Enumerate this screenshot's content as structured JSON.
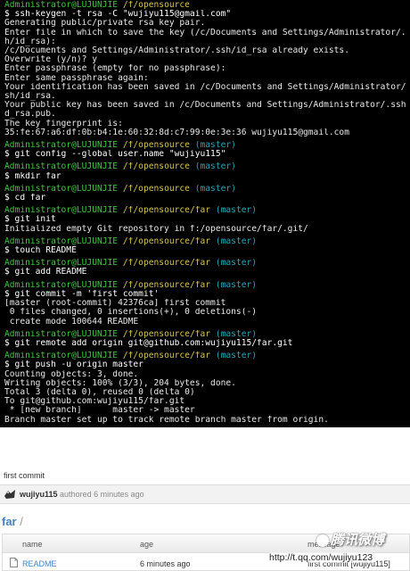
{
  "terminal": {
    "panels": [
      {
        "prompt": {
          "user": "Administrator@LUJUNJIE",
          "path": "/f/opensource",
          "branch": ""
        },
        "lines": [
          {
            "t": "cmd",
            "s": "$ ssh-keygen -t rsa -C \"wujiyu115@gmail.com\""
          },
          {
            "t": "out",
            "s": "Generating public/private rsa key pair."
          },
          {
            "t": "out",
            "s": "Enter file in which to save the key (/c/Documents and Settings/Administrator/.ss"
          },
          {
            "t": "out",
            "s": "h/id_rsa):"
          },
          {
            "t": "out",
            "s": "/c/Documents and Settings/Administrator/.ssh/id_rsa already exists."
          },
          {
            "t": "out",
            "s": "Overwrite (y/n)? y"
          },
          {
            "t": "out",
            "s": "Enter passphrase (empty for no passphrase):"
          },
          {
            "t": "out",
            "s": "Enter same passphrase again:"
          },
          {
            "t": "out",
            "s": "Your identification has been saved in /c/Documents and Settings/Administrator/.s"
          },
          {
            "t": "out",
            "s": "sh/id_rsa."
          },
          {
            "t": "out",
            "s": "Your public key has been saved in /c/Documents and Settings/Administrator/.ssh/i"
          },
          {
            "t": "out",
            "s": "d_rsa.pub."
          },
          {
            "t": "out",
            "s": "The key fingerprint is:"
          },
          {
            "t": "out",
            "s": "35:fe:67:a6:df:0b:b4:1e:60:32:8d:c7:99:0e:3e:36 wujiyu115@gmail.com"
          }
        ]
      },
      {
        "prompt": {
          "user": "Administrator@LUJUNJIE",
          "path": "/f/opensource",
          "branch": "(master)"
        },
        "lines": [
          {
            "t": "cmd",
            "s": "$ git config --global user.name \"wujiyu115\""
          }
        ]
      },
      {
        "prompt": {
          "user": "Administrator@LUJUNJIE",
          "path": "/f/opensource",
          "branch": "(master)"
        },
        "lines": [
          {
            "t": "cmd",
            "s": "$ mkdir far"
          }
        ]
      },
      {
        "prompt": {
          "user": "Administrator@LUJUNJIE",
          "path": "/f/opensource",
          "branch": "(master)"
        },
        "lines": [
          {
            "t": "cmd",
            "s": "$ cd far"
          }
        ]
      },
      {
        "prompt": {
          "user": "Administrator@LUJUNJIE",
          "path": "/f/opensource/far",
          "branch": "(master)"
        },
        "lines": [
          {
            "t": "cmd",
            "s": "$ git init"
          },
          {
            "t": "out",
            "s": "Initialized empty Git repository in f:/opensource/far/.git/"
          }
        ]
      },
      {
        "prompt": {
          "user": "Administrator@LUJUNJIE",
          "path": "/f/opensource/far",
          "branch": "(master)"
        },
        "lines": [
          {
            "t": "cmd",
            "s": "$ touch README"
          }
        ]
      },
      {
        "prompt": {
          "user": "Administrator@LUJUNJIE",
          "path": "/f/opensource/far",
          "branch": "(master)"
        },
        "lines": [
          {
            "t": "cmd",
            "s": "$ git add README"
          }
        ]
      },
      {
        "prompt": {
          "user": "Administrator@LUJUNJIE",
          "path": "/f/opensource/far",
          "branch": "(master)"
        },
        "lines": [
          {
            "t": "cmd",
            "s": "$ git commit -m 'first commit'"
          },
          {
            "t": "out",
            "s": "[master (root-commit) 42376ca] first commit"
          },
          {
            "t": "out",
            "s": " 0 files changed, 0 insertions(+), 0 deletions(-)"
          },
          {
            "t": "out",
            "s": " create mode 100644 README"
          }
        ]
      },
      {
        "prompt": {
          "user": "Administrator@LUJUNJIE",
          "path": "/f/opensource/far",
          "branch": "(master)"
        },
        "lines": [
          {
            "t": "cmd",
            "s": "$ git remote add origin git@github.com:wujiyu115/far.git"
          }
        ]
      },
      {
        "prompt": {
          "user": "Administrator@LUJUNJIE",
          "path": "/f/opensource/far",
          "branch": "(master)"
        },
        "lines": [
          {
            "t": "cmd",
            "s": "$ git push -u origin master"
          },
          {
            "t": "out",
            "s": "Counting objects: 3, done."
          },
          {
            "t": "out",
            "s": "Writing objects: 100% (3/3), 204 bytes, done."
          },
          {
            "t": "out",
            "s": "Total 3 (delta 0), reused 0 (delta 0)"
          },
          {
            "t": "out",
            "s": "To git@github.com:wujiyu115/far.git"
          },
          {
            "t": "out",
            "s": " * [new branch]      master -> master"
          },
          {
            "t": "out",
            "s": "Branch master set up to track remote branch master from origin."
          }
        ]
      }
    ]
  },
  "github": {
    "commit_message": "first commit",
    "author": "wujiyu115",
    "authored_text": "authored 6 minutes ago",
    "repo_name": "far",
    "repo_slash": "/",
    "table_headers": {
      "name": "name",
      "age": "age",
      "message": "message"
    },
    "rows": [
      {
        "name": "README",
        "age": "6 minutes ago",
        "message": "first commit [wujiyu115]"
      }
    ]
  },
  "watermark": {
    "logo_text": "腾讯微博",
    "url": "http://t.qq.com/wujiyu123"
  },
  "colors": {
    "terminal_bg": "#000000",
    "prompt_green": "#3cc73c",
    "path_yellow": "#d8c44a",
    "branch_cyan": "#1fa8b8",
    "link_blue": "#4183c4"
  }
}
